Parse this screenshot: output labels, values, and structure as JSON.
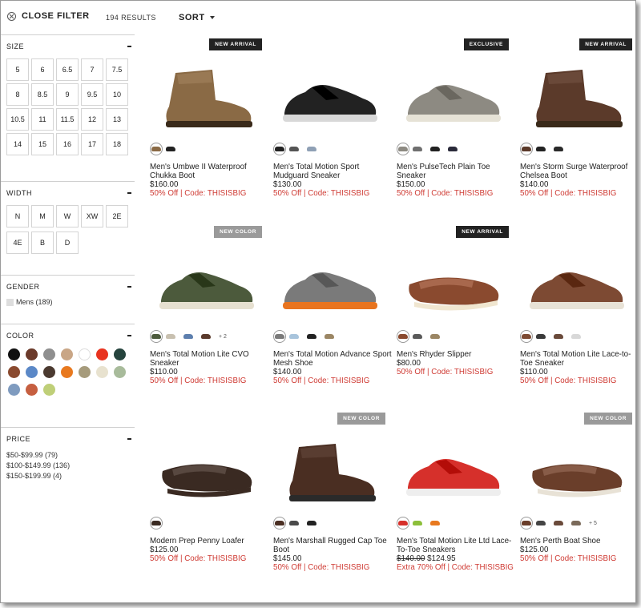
{
  "header": {
    "close_filter": "CLOSE FILTER",
    "results": "194 RESULTS",
    "sort": "SORT"
  },
  "filters": {
    "size": {
      "title": "SIZE",
      "options": [
        "5",
        "6",
        "6.5",
        "7",
        "7.5",
        "8",
        "8.5",
        "9",
        "9.5",
        "10",
        "10.5",
        "11",
        "11.5",
        "12",
        "13",
        "14",
        "15",
        "16",
        "17",
        "18"
      ]
    },
    "width": {
      "title": "WIDTH",
      "options": [
        "N",
        "M",
        "W",
        "XW",
        "2E",
        "4E",
        "B",
        "D"
      ]
    },
    "gender": {
      "title": "GENDER",
      "options": [
        "Mens (189)"
      ]
    },
    "color": {
      "title": "COLOR",
      "swatches": [
        "#111111",
        "#6b3a2a",
        "#8f8f8f",
        "#c9a686",
        "#ffffff",
        "#e8331f",
        "#26443e",
        "#8a4a2f",
        "#5b88c7",
        "#4b3a30",
        "#e8791f",
        "#a69b7c",
        "#e8e2cf",
        "#a8bb9b",
        "#7f9bbf",
        "#c65f40",
        "#bfcf78"
      ]
    },
    "price": {
      "title": "PRICE",
      "options": [
        "$50-$99.99 (79)",
        "$100-$149.99 (136)",
        "$150-$199.99 (4)"
      ]
    }
  },
  "products": [
    {
      "name": "Men's Umbwe II Waterproof Chukka Boot",
      "price": "$160.00",
      "promo": "50% Off | Code: THISISBIG",
      "badge": "NEW ARRIVAL",
      "swatches": [
        "#8a6a45",
        "#222222"
      ]
    },
    {
      "name": "Men's Total Motion Sport Mudguard Sneaker",
      "price": "$130.00",
      "promo": "50% Off | Code: THISISBIG",
      "badge": "",
      "swatches": [
        "#222222",
        "#555555",
        "#8fa0b5"
      ]
    },
    {
      "name": "Men's PulseTech Plain Toe Sneaker",
      "price": "$150.00",
      "promo": "50% Off | Code: THISISBIG",
      "badge": "EXCLUSIVE",
      "swatches": [
        "#8d8a82",
        "#6f6f6f",
        "#222222",
        "#2a2a3a"
      ]
    },
    {
      "name": "Men's Storm Surge Waterproof Chelsea Boot",
      "price": "$140.00",
      "promo": "50% Off | Code: THISISBIG",
      "badge": "NEW ARRIVAL",
      "swatches": [
        "#5b3a2a",
        "#222222",
        "#2a2a2a"
      ]
    },
    {
      "name": "Men's Total Motion Lite CVO Sneaker",
      "price": "$110.00",
      "promo": "50% Off | Code: THISISBIG",
      "badge": "NEW COLOR",
      "swatches": [
        "#4c5a3c",
        "#c8c0b0",
        "#5d7fae",
        "#5a3a2c"
      ],
      "more": "+ 2"
    },
    {
      "name": "Men's Total Motion Advance Sport Mesh Shoe",
      "price": "$140.00",
      "promo": "50% Off | Code: THISISBIG",
      "badge": "",
      "swatches": [
        "#7a7a7a",
        "#a8c4dc",
        "#222222",
        "#9b8664"
      ]
    },
    {
      "name": "Men's Rhyder Slipper",
      "price": "$80.00",
      "promo": "50% Off | Code: THISISBIG",
      "badge": "NEW ARRIVAL",
      "swatches": [
        "#8a4a2f",
        "#5a5a5a",
        "#9b8664"
      ]
    },
    {
      "name": "Men's Total Motion Lite Lace-to-Toe Sneaker",
      "price": "$110.00",
      "promo": "50% Off | Code: THISISBIG",
      "badge": "",
      "swatches": [
        "#7d4a33",
        "#3a3a3a",
        "#6a4a3a",
        "#d8d8d8"
      ]
    },
    {
      "name": "Modern Prep Penny Loafer",
      "price": "$125.00",
      "promo": "50% Off | Code: THISISBIG",
      "badge": "",
      "swatches": [
        "#3a2a22"
      ]
    },
    {
      "name": "Men's Marshall Rugged Cap Toe Boot",
      "price": "$145.00",
      "promo": "50% Off | Code: THISISBIG",
      "badge": "NEW COLOR",
      "swatches": [
        "#4a2e22",
        "#4a4a4a",
        "#222222"
      ]
    },
    {
      "name": "Men's Total Motion Lite Ltd Lace-To-Toe Sneakers",
      "original_price": "$140.00",
      "price": "$124.95",
      "promo": "Extra 70% Off | Code: THISISBIG",
      "badge": "",
      "swatches": [
        "#d6302b",
        "#8cbf3a",
        "#e8791f"
      ]
    },
    {
      "name": "Men's Perth Boat Shoe",
      "price": "$125.00",
      "promo": "50% Off | Code: THISISBIG",
      "badge": "NEW COLOR",
      "swatches": [
        "#6a3e2a",
        "#444444",
        "#6a4a3a",
        "#7a6a5a"
      ],
      "more": "+ 5"
    }
  ]
}
